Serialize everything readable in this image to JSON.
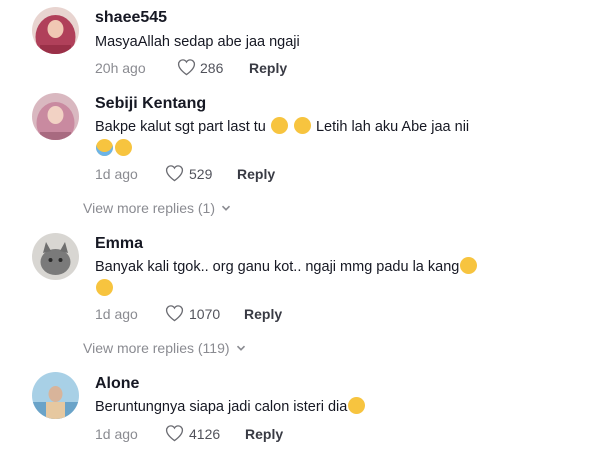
{
  "comments": [
    {
      "username": "shaee545",
      "text": "MasyaAllah sedap abe jaa ngaji",
      "time": "20h ago",
      "likes": "286",
      "reply_label": "Reply",
      "avatar_color": "#b0405a"
    },
    {
      "username": "Sebiji Kentang",
      "text_line1": "Bakpe kalut sgt part last tu",
      "text_line1b": "Letih lah aku Abe jaa nii",
      "time": "1d ago",
      "likes": "529",
      "reply_label": "Reply",
      "avatar_color": "#c98aa0",
      "view_more": "View more replies (1)"
    },
    {
      "username": "Emma",
      "text": "Banyak kali tgok.. org ganu kot.. ngaji mmg padu la kang",
      "time": "1d ago",
      "likes": "1070",
      "reply_label": "Reply",
      "avatar_color": "#7a7a7a",
      "view_more": "View more replies (119)"
    },
    {
      "username": "Alone",
      "text": "Beruntungnya siapa jadi calon isteri dia",
      "time": "1d ago",
      "likes": "4126",
      "reply_label": "Reply",
      "avatar_color": "#6aa3c8"
    }
  ],
  "icons": {
    "like": "heart-outline-icon",
    "expand": "chevron-down-icon",
    "laugh_emoji": "rolling-on-floor-laughing-emoji",
    "cry_emoji": "loudly-crying-emoji",
    "shush_emoji": "face-with-hand-over-mouth-emoji",
    "pleading_emoji": "pleading-face-emoji"
  },
  "colors": {
    "text_primary": "#161823",
    "text_secondary": "#8a8b91",
    "emoji_yellow": "#f7c43f"
  }
}
